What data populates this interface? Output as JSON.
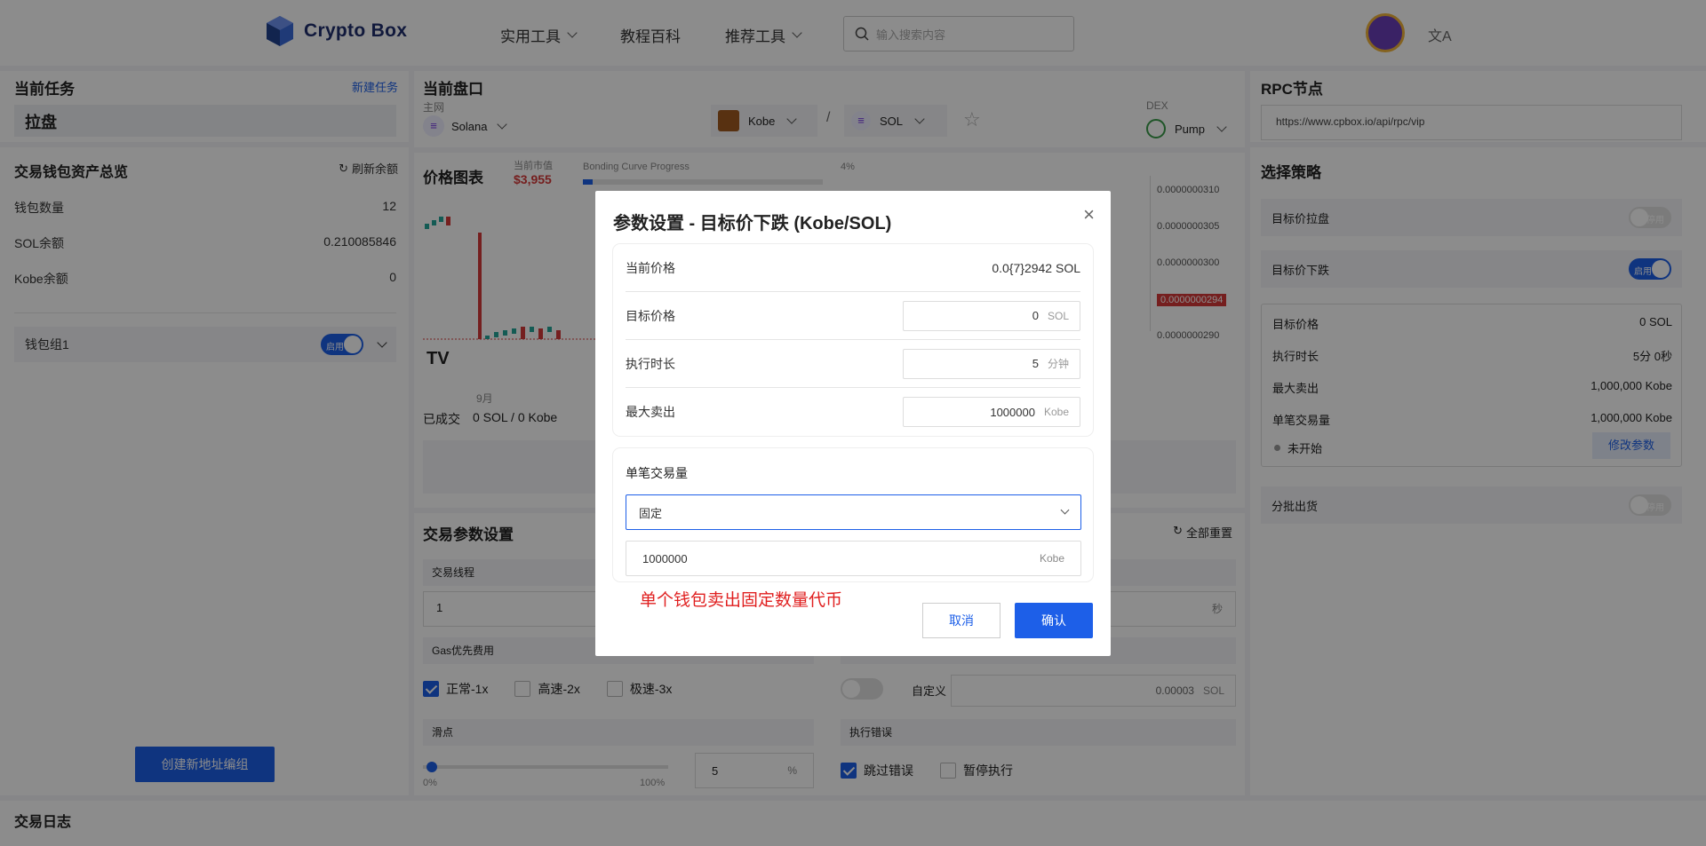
{
  "header": {
    "brand": "Crypto Box",
    "nav": [
      {
        "label": "实用工具",
        "dropdown": true
      },
      {
        "label": "教程百科",
        "dropdown": false
      },
      {
        "label": "推荐工具",
        "dropdown": true
      }
    ],
    "search_placeholder": "输入搜索内容",
    "lang_icon": "文A"
  },
  "left": {
    "task_title": "当前任务",
    "new_task": "新建任务",
    "task_name": "拉盘",
    "wallet_title": "交易钱包资产总览",
    "refresh": "刷新余额",
    "rows": [
      {
        "label": "钱包数量",
        "value": "12"
      },
      {
        "label": "SOL余额",
        "value": "0.210085846"
      },
      {
        "label": "Kobe余额",
        "value": "0"
      }
    ],
    "group": "钱包组1",
    "group_toggle": "启用",
    "create_btn": "创建新地址编组",
    "log_title": "交易日志"
  },
  "center": {
    "title": "当前盘口",
    "net_label": "主网",
    "net": "Solana",
    "token_a": "Kobe",
    "sep": "/",
    "token_b": "SOL",
    "dex_label": "DEX",
    "dex": "Pump",
    "chart_title": "价格图表",
    "mcap_label": "当前市值",
    "mcap": "$3,955",
    "bonding_label": "Bonding Curve Progress",
    "bonding_pct": "4%",
    "bonding_progress": 0.04,
    "price_ticks": [
      "0.0000000310",
      "0.0000000305",
      "0.0000000300",
      "0.0000000294",
      "0.0000000290"
    ],
    "month": "9月",
    "deal_label": "已成交",
    "deal_value": "0 SOL / 0 Kobe",
    "params_title": "交易参数设置",
    "reset_all": "全部重置",
    "thread_label": "交易线程",
    "thread_value": "1",
    "sec_unit": "秒",
    "gas_label": "Gas优先费用",
    "gas_options": [
      {
        "label": "正常-1x",
        "checked": true
      },
      {
        "label": "高速-2x",
        "checked": false
      },
      {
        "label": "极速-3x",
        "checked": false
      }
    ],
    "custom_label": "自定义",
    "custom_value": "0.00003",
    "custom_unit": "SOL",
    "slip_label": "滑点",
    "slip_min": "0%",
    "slip_max": "100%",
    "slip_value": "5",
    "slip_unit": "%",
    "err_label": "执行错误",
    "err_options": [
      {
        "label": "跳过错误",
        "checked": true
      },
      {
        "label": "暂停执行",
        "checked": false
      }
    ]
  },
  "right": {
    "rpc_title": "RPC节点",
    "rpc_value": "https://www.cpbox.io/api/rpc/vip",
    "strategy_title": "选择策略",
    "strategies": [
      {
        "label": "目标价拉盘",
        "on": false,
        "toggle": "停用"
      },
      {
        "label": "目标价下跌",
        "on": true,
        "toggle": "启用"
      }
    ],
    "summary": [
      {
        "label": "目标价格",
        "value": "0 SOL"
      },
      {
        "label": "执行时长",
        "value": "5分 0秒"
      },
      {
        "label": "最大卖出",
        "value": "1,000,000 Kobe"
      },
      {
        "label": "单笔交易量",
        "value": "1,000,000 Kobe"
      }
    ],
    "status": "未开始",
    "modify_btn": "修改参数",
    "batch_label": "分批出货",
    "batch_toggle": "停用"
  },
  "modal": {
    "title": "参数设置 - 目标价下跌 (Kobe/SOL)",
    "current_price_label": "当前价格",
    "current_price": "0.0{7}2942 SOL",
    "target_label": "目标价格",
    "target_value": "0",
    "target_unit": "SOL",
    "duration_label": "执行时长",
    "duration_value": "5",
    "duration_unit": "分钟",
    "max_sell_label": "最大卖出",
    "max_sell_value": "1000000",
    "max_sell_unit": "Kobe",
    "per_trade_label": "单笔交易量",
    "mode_value": "固定",
    "amount_value": "1000000",
    "amount_unit": "Kobe",
    "hint": "单个钱包卖出固定数量代币",
    "cancel": "取消",
    "confirm": "确认"
  }
}
